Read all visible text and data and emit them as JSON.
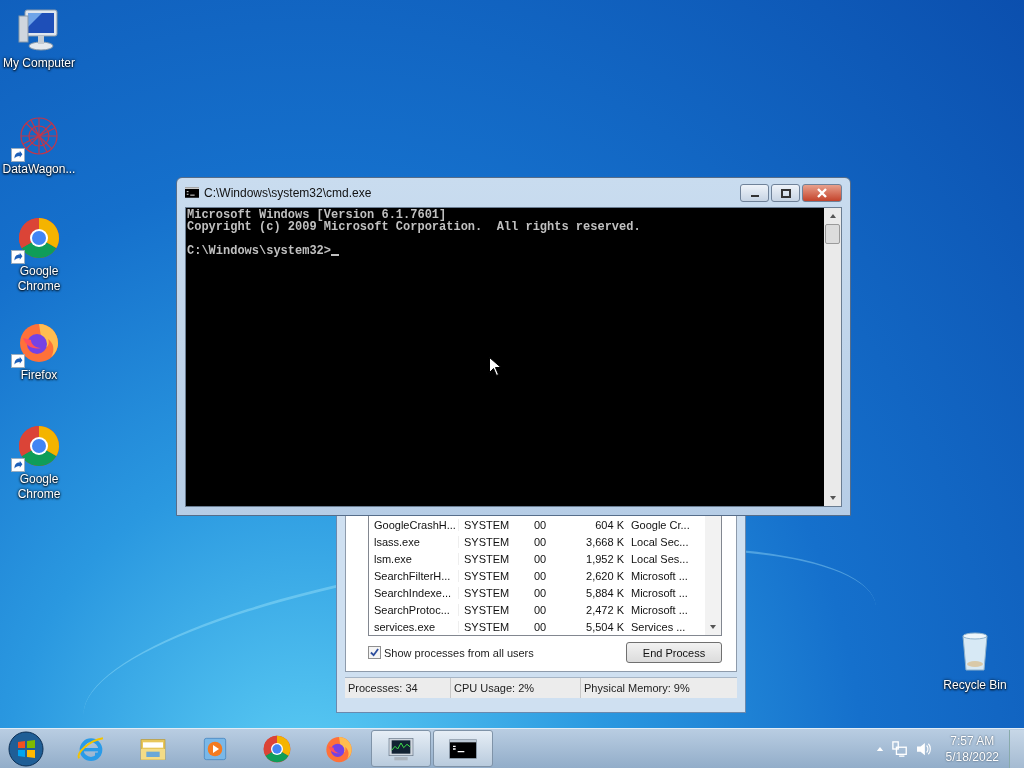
{
  "desktop_icons": [
    {
      "label": "My Computer",
      "kind": "computer",
      "shortcut": false
    },
    {
      "label": "DataWagon...",
      "kind": "web",
      "shortcut": true
    },
    {
      "label": "Google Chrome",
      "kind": "chrome",
      "shortcut": true
    },
    {
      "label": "Firefox",
      "kind": "firefox",
      "shortcut": true
    },
    {
      "label": "Google Chrome",
      "kind": "chrome",
      "shortcut": true
    },
    {
      "label": "Recycle Bin",
      "kind": "recycle",
      "shortcut": false
    }
  ],
  "cmd_window": {
    "title": "C:\\Windows\\system32\\cmd.exe",
    "output": [
      "Microsoft Windows [Version 6.1.7601]",
      "Copyright (c) 2009 Microsoft Corporation.  All rights reserved."
    ],
    "prompt": "C:\\Windows\\system32>"
  },
  "task_manager": {
    "rows": [
      [
        "GoogleCrashH...",
        "SYSTEM",
        "00",
        "604 K",
        "Google Cr..."
      ],
      [
        "lsass.exe",
        "SYSTEM",
        "00",
        "3,668 K",
        "Local Sec..."
      ],
      [
        "lsm.exe",
        "SYSTEM",
        "00",
        "1,952 K",
        "Local Ses..."
      ],
      [
        "SearchFilterH...",
        "SYSTEM",
        "00",
        "2,620 K",
        "Microsoft ..."
      ],
      [
        "SearchIndexe...",
        "SYSTEM",
        "00",
        "5,884 K",
        "Microsoft ..."
      ],
      [
        "SearchProtoc...",
        "SYSTEM",
        "00",
        "2,472 K",
        "Microsoft ..."
      ],
      [
        "services.exe",
        "SYSTEM",
        "00",
        "5,504 K",
        "Services ..."
      ]
    ],
    "show_all_users": {
      "label": "Show processes from all users",
      "checked": true
    },
    "end_button": "End Process",
    "status_bar": [
      "Processes: 34",
      "CPU Usage: 2%",
      "Physical Memory: 9%"
    ]
  },
  "taskbar": {
    "items": [
      {
        "kind": "ie",
        "running": false
      },
      {
        "kind": "explorer",
        "running": false
      },
      {
        "kind": "media",
        "running": false
      },
      {
        "kind": "chrome",
        "running": false
      },
      {
        "kind": "firefox",
        "running": false
      },
      {
        "kind": "taskmgr",
        "running": true
      },
      {
        "kind": "cmd",
        "running": true
      }
    ],
    "time": "7:57 AM",
    "date": "5/18/2022"
  }
}
